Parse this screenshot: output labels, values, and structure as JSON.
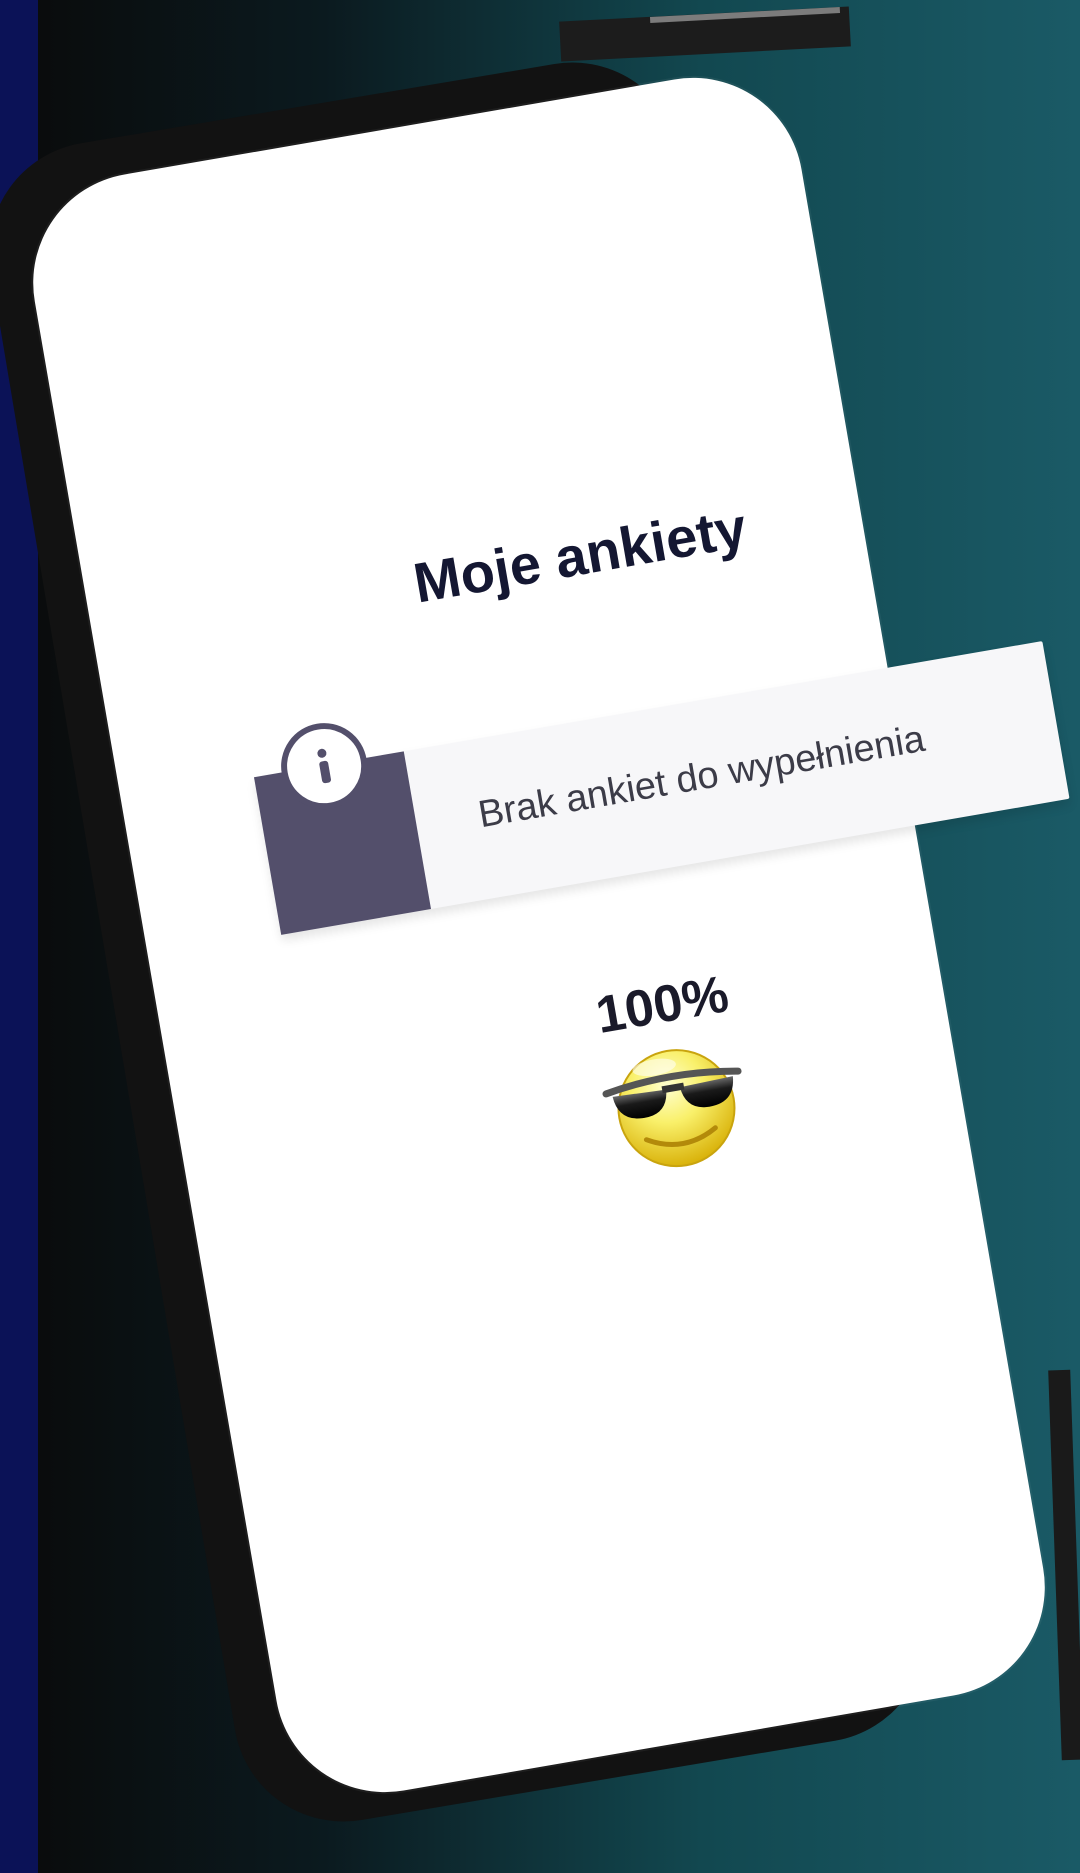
{
  "title": "Moje ankiety",
  "info": {
    "message": "Brak ankiet do wypełnienia",
    "icon": "info-icon"
  },
  "progress": {
    "label": "100%",
    "value": 100
  },
  "emoji": {
    "icon": "sunglasses-smiley-icon"
  },
  "colors": {
    "badge": "#534f6b",
    "title": "#141732",
    "banner_bg": "#f7f7f9",
    "left_strip": "#0b1257"
  }
}
